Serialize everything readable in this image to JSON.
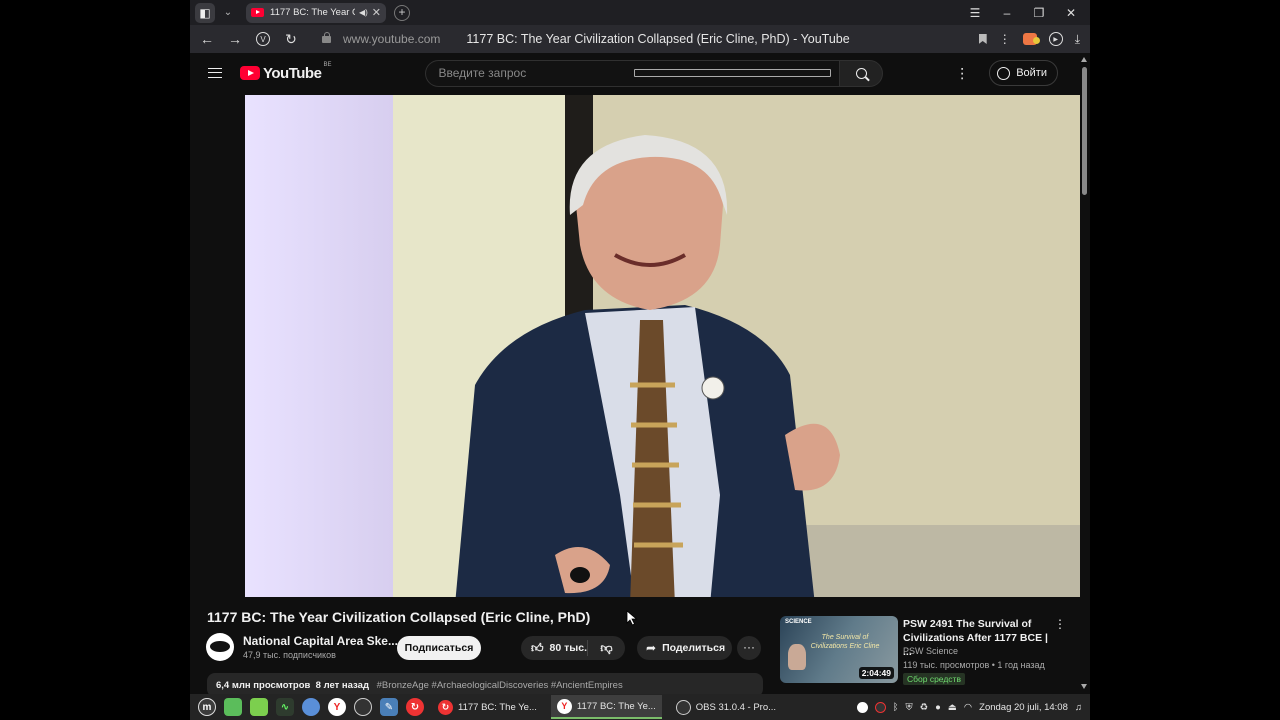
{
  "browser": {
    "tab_title": "1177 BC: The Year Civilization Collapsed",
    "url_domain": "www.youtube.com",
    "page_title": "1177 BC: The Year Civilization Collapsed (Eric Cline, PhD) - YouTube"
  },
  "youtube": {
    "logo_text": "YouTube",
    "region": "BE",
    "search_placeholder": "Введите запрос",
    "signin_label": "Войти"
  },
  "video": {
    "title": "1177 BC: The Year Civilization Collapsed (Eric Cline, PhD)",
    "channel_name": "National Capital Area Ske...",
    "subscribers": "47,9 тыс. подписчиков",
    "subscribe_label": "Подписаться",
    "likes": "80 тыс.",
    "share_label": "Поделиться",
    "more_label": "···",
    "views": "6,4 млн просмотров",
    "age": "8 лет назад",
    "tags": "#BronzeAge #ArchaeologicalDiscoveries #AncientEmpires"
  },
  "recommendation": {
    "title": "PSW 2491 The Survival of Civilizations After 1177 BCE | ...",
    "channel": "PSW Science",
    "meta": "119 тыс. просмотров • 1 год назад",
    "badge": "Сбор средств",
    "duration": "2:04:49",
    "thumb_brand": "SCIENCE",
    "thumb_title": "The Survival of Civilizations Eric Cline"
  },
  "taskbar": {
    "task1": "1177 BC: The Ye...",
    "task2": "1177 BC: The Ye...",
    "task3": "OBS 31.0.4 - Pro...",
    "clock": "Zondag 20 juli, 14:08"
  },
  "colors": {
    "youtube_red": "#ff0033",
    "page_bg": "#0f0f0f",
    "button_bg": "#272727",
    "badge_green": "#6fdc6f"
  }
}
